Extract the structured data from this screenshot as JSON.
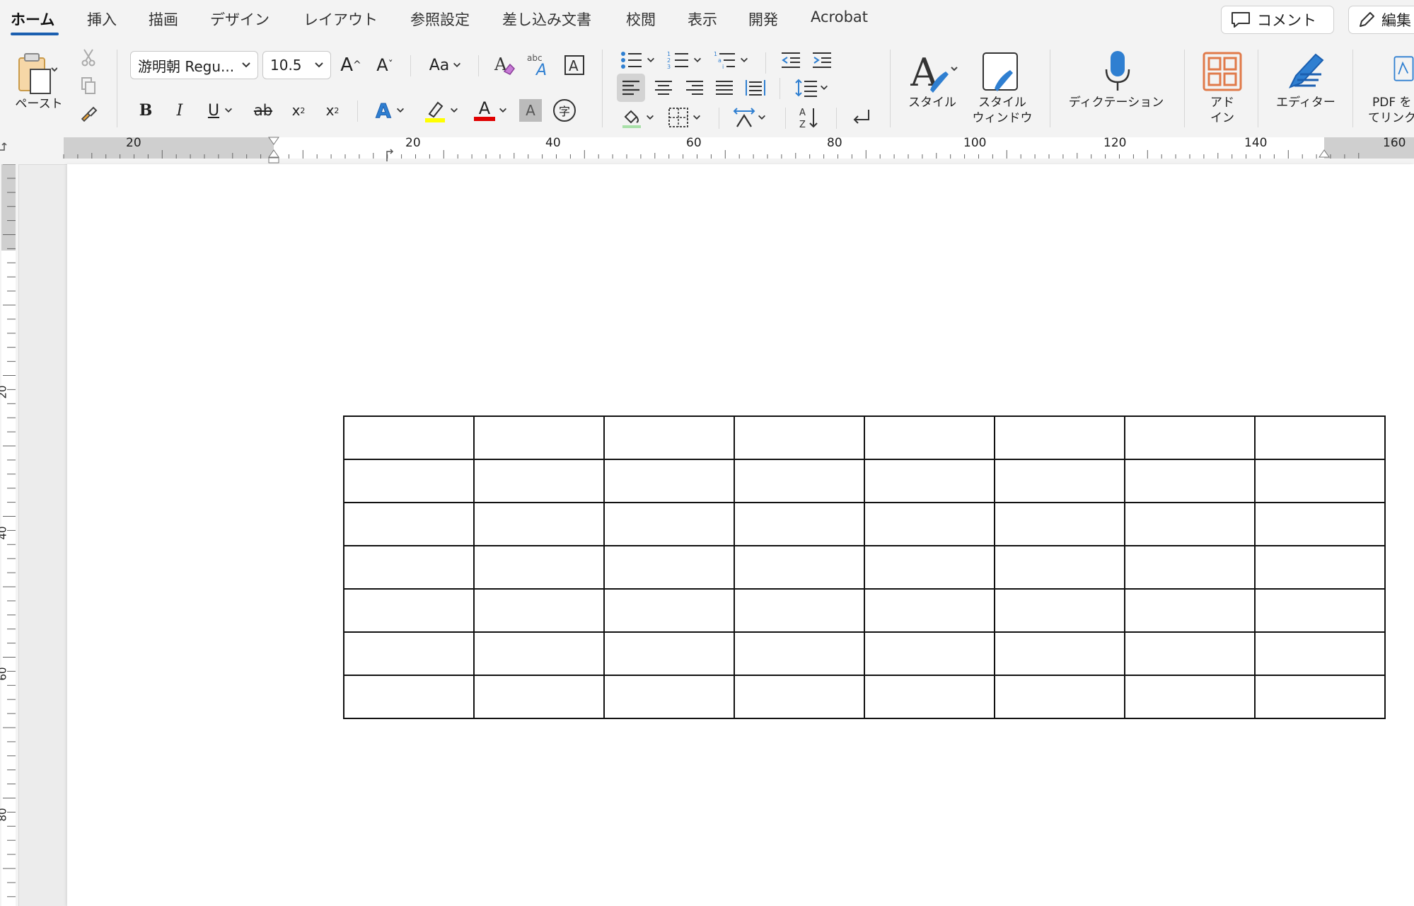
{
  "tabs": [
    {
      "label": "ホーム",
      "active": true
    },
    {
      "label": "挿入"
    },
    {
      "label": "描画"
    },
    {
      "label": "デザイン"
    },
    {
      "label": "レイアウト"
    },
    {
      "label": "参照設定"
    },
    {
      "label": "差し込み文書"
    },
    {
      "label": "校閲"
    },
    {
      "label": "表示"
    },
    {
      "label": "開発"
    },
    {
      "label": "Acrobat"
    }
  ],
  "top_buttons": {
    "comment": "コメント",
    "edit": "編集"
  },
  "ribbon": {
    "paste_label": "ペースト",
    "font_name": "游明朝 Regu...",
    "font_size": "10.5",
    "grow_font": "A",
    "shrink_font": "A",
    "change_case": "Aa",
    "bold": "B",
    "italic": "I",
    "underline": "U",
    "strike": "ab",
    "subscript": "x",
    "superscript": "x",
    "text_effect": "A",
    "font_color": "A",
    "char_shading": "A",
    "enclose_char": "字",
    "styles_label": "スタイル",
    "style_window_label_1": "スタイル",
    "style_window_label_2": "ウィンドウ",
    "dictation_label": "ディクテーション",
    "addins_label_1": "アド",
    "addins_label_2": "イン",
    "editor_label": "エディター",
    "pdf_label_1": "PDF を",
    "pdf_label_2": "てリンク"
  },
  "colors": {
    "accent": "#1b5fb0",
    "highlight": "#ffff00",
    "font_color": "#e00000",
    "addins": "#e07a4a",
    "icon_blue": "#2f7fd1"
  },
  "ruler": {
    "h_labels": [
      "20",
      "20",
      "40",
      "60",
      "80",
      "100",
      "120",
      "140",
      "160"
    ],
    "v_labels": [
      "20",
      "40",
      "60",
      "80"
    ]
  },
  "table": {
    "rows": 7,
    "cols": 8
  }
}
